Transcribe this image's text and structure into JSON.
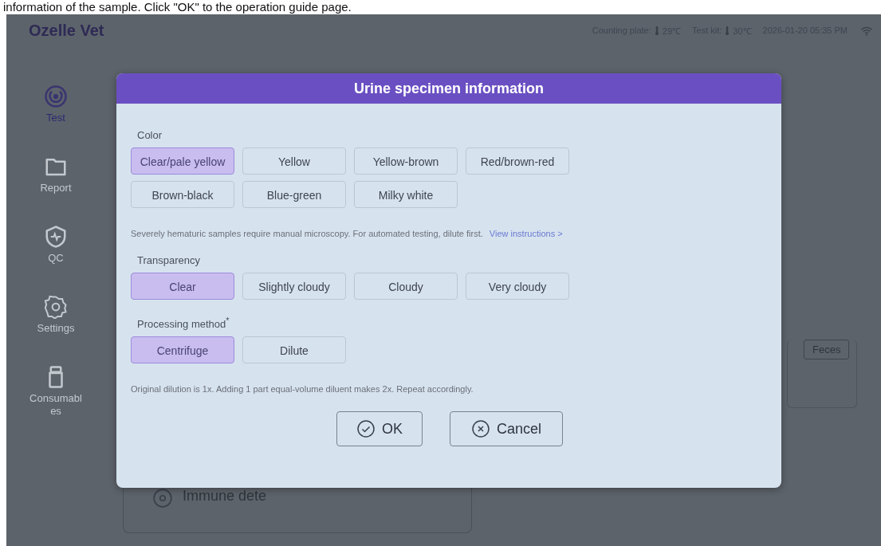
{
  "caption": "information of the sample. Click \"OK\" to the operation guide page.",
  "app": {
    "title": "Ozelle Vet"
  },
  "status_bar": {
    "counting_plate_label": "Counting plate:",
    "counting_plate_temp": "29℃",
    "test_kit_label": "Test kit:",
    "test_kit_temp": "30℃",
    "datetime": "2026-01-20  05:35 PM"
  },
  "sidebar": {
    "items": [
      {
        "label": "Test",
        "selected": true
      },
      {
        "label": "Report",
        "selected": false
      },
      {
        "label": "QC",
        "selected": false
      },
      {
        "label": "Settings",
        "selected": false
      },
      {
        "label": "Consumables",
        "selected": false
      }
    ]
  },
  "background": {
    "sample_button": "Feces",
    "card_title": "Immune dete"
  },
  "dialog": {
    "title": "Urine specimen information",
    "sections": [
      {
        "label": "Color",
        "options": [
          {
            "label": "Clear/pale yellow",
            "selected": true
          },
          {
            "label": "Yellow",
            "selected": false
          },
          {
            "label": "Yellow-brown",
            "selected": false
          },
          {
            "label": "Red/brown-red",
            "selected": false
          },
          {
            "label": "Brown-black",
            "selected": false
          },
          {
            "label": "Blue-green",
            "selected": false
          },
          {
            "label": "Milky white",
            "selected": false
          }
        ],
        "note": "Severely hematuric samples require manual microscopy. For automated testing, dilute first.",
        "link": "View instructions >"
      },
      {
        "label": "Transparency",
        "options": [
          {
            "label": "Clear",
            "selected": true
          },
          {
            "label": "Slightly cloudy",
            "selected": false
          },
          {
            "label": "Cloudy",
            "selected": false
          },
          {
            "label": "Very cloudy",
            "selected": false
          }
        ]
      },
      {
        "label": "Processing method$^{*}$",
        "options": [
          {
            "label": "Centrifuge",
            "selected": true
          },
          {
            "label": "Dilute",
            "selected": false
          }
        ],
        "note": "Original dilution is 1x. Adding 1 part equal-volume diluent makes 2x. Repeat accordingly."
      }
    ],
    "buttons": [
      {
        "label": "OK",
        "kind": "ok"
      },
      {
        "label": "Cancel",
        "kind": "cancel"
      }
    ]
  }
}
